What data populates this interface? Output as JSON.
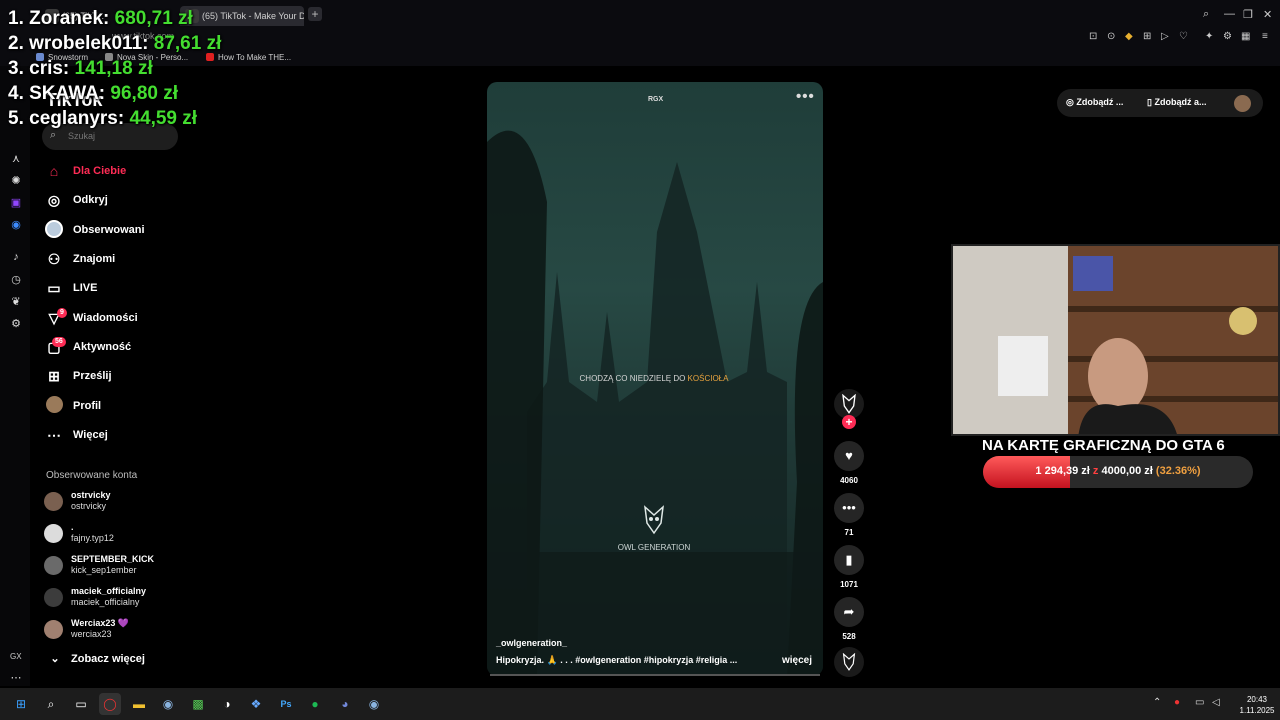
{
  "browser": {
    "tabs": [
      {
        "label": "(65) TikT..."
      },
      {
        "label": "(65) TikTok - Make Your D"
      }
    ],
    "new_tab": "+",
    "url": "www.tiktok.com",
    "bookmarks": [
      "Snowstorm",
      "Nova Skin - Perso...",
      "How To Make THE..."
    ]
  },
  "donations": [
    {
      "rank_name": "1. Zoranek:",
      "amount": "680,71 zł"
    },
    {
      "rank_name": "2. wrobelek011:",
      "amount": "87,61 zł"
    },
    {
      "rank_name": "3. cris:",
      "amount": "141,18 zł"
    },
    {
      "rank_name": "4. SKAWA:",
      "amount": "96,80 zł"
    },
    {
      "rank_name": "5. ceglanyrs:",
      "amount": "44,59 zł"
    }
  ],
  "tiktok": {
    "logo": "TikTok",
    "search_placeholder": "Szukaj",
    "nav": [
      {
        "label": "Dla Ciebie",
        "icon": "home-icon"
      },
      {
        "label": "Odkryj",
        "icon": "compass-icon"
      },
      {
        "label": "Obserwowani",
        "icon": "following-avatar-icon"
      },
      {
        "label": "Znajomi",
        "icon": "friends-icon"
      },
      {
        "label": "LIVE",
        "icon": "live-icon"
      },
      {
        "label": "Wiadomości",
        "icon": "messages-icon",
        "badge": "9"
      },
      {
        "label": "Aktywność",
        "icon": "activity-icon",
        "badge": "56"
      },
      {
        "label": "Prześlij",
        "icon": "upload-icon"
      },
      {
        "label": "Profil",
        "icon": "profile-avatar-icon"
      },
      {
        "label": "Więcej",
        "icon": "more-icon"
      }
    ],
    "followed_header": "Obserwowane konta",
    "followed": [
      {
        "username": "ostrvicky",
        "handle": "ostrvicky"
      },
      {
        "username": ".",
        "handle": "fajny.typ12"
      },
      {
        "username": "SEPTEMBER_KICK",
        "handle": "kick_sep1ember"
      },
      {
        "username": "maciek_officialny",
        "handle": "maciek_officialny"
      },
      {
        "username": "Werciax23 💜",
        "handle": "werciax23"
      }
    ],
    "see_more": "Zobacz więcej"
  },
  "video": {
    "watermark": "RGX",
    "caption_a": "CHODZĄ CO NIEDZIELĘ DO ",
    "caption_b": "KOŚCIOŁA",
    "brand": "OWL GENERATION",
    "author": "_owlgeneration_",
    "description": "Hipokryzja. 🙏 . . . #owlgeneration #hipokryzja #religia ...",
    "more": "więcej",
    "likes": "4060",
    "comments": "71",
    "saves": "1071",
    "shares": "528"
  },
  "top_right": {
    "pill1": "Zdobądź ...",
    "pill2": "Zdobądź a..."
  },
  "goal": {
    "title": "NA KARTĘ GRAFICZNĄ DO GTA 6",
    "current": "1 294,39 zł",
    "sep": " z ",
    "target": "4000,00 zł",
    "percent": "(32.36%)",
    "fraction": 0.3236
  },
  "taskbar": {
    "time": "20:43",
    "date": "1.11.2025"
  },
  "gx_label": "GX"
}
